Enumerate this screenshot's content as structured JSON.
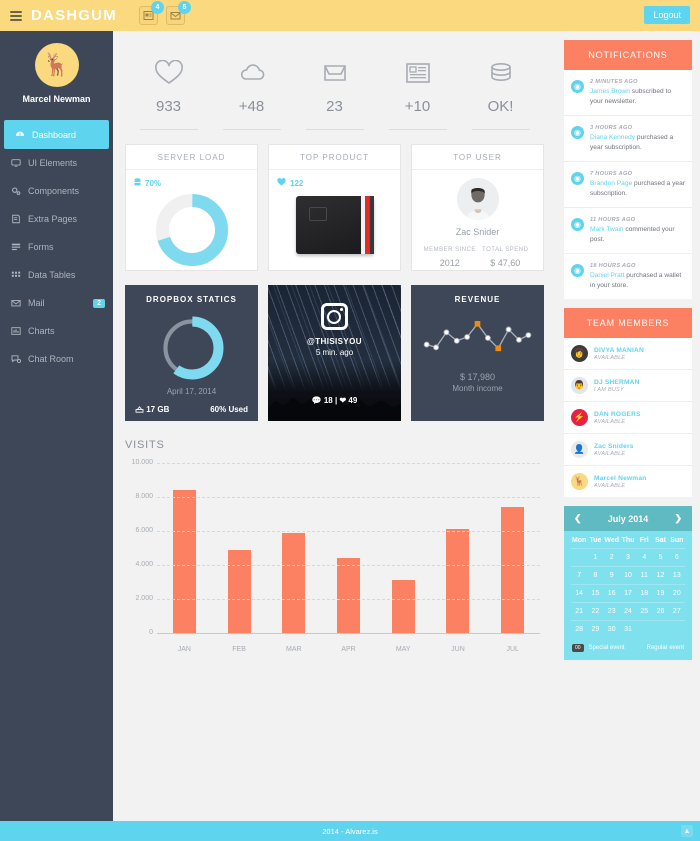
{
  "header": {
    "brand": "DASHGUM",
    "menu_icon": "hamburger-icon",
    "tasks_badge": "4",
    "mail_badge": "5",
    "logout_label": "Logout"
  },
  "sidebar": {
    "profile_name": "Marcel Newman",
    "avatar_glyph": "🦌",
    "items": [
      {
        "label": "Dashboard",
        "icon": "dashboard-icon",
        "active": true,
        "badge": ""
      },
      {
        "label": "UI Elements",
        "icon": "monitor-icon",
        "active": false,
        "badge": ""
      },
      {
        "label": "Components",
        "icon": "gear-icon",
        "active": false,
        "badge": ""
      },
      {
        "label": "Extra Pages",
        "icon": "book-icon",
        "active": false,
        "badge": ""
      },
      {
        "label": "Forms",
        "icon": "form-icon",
        "active": false,
        "badge": ""
      },
      {
        "label": "Data Tables",
        "icon": "grid-icon",
        "active": false,
        "badge": ""
      },
      {
        "label": "Mail",
        "icon": "envelope-icon",
        "active": false,
        "badge": "2"
      },
      {
        "label": "Charts",
        "icon": "chart-icon",
        "active": false,
        "badge": ""
      },
      {
        "label": "Chat Room",
        "icon": "chat-icon",
        "active": false,
        "badge": ""
      }
    ]
  },
  "stats": [
    {
      "icon": "heart-icon",
      "value": "933"
    },
    {
      "icon": "cloud-icon",
      "value": "+48"
    },
    {
      "icon": "inbox-icon",
      "value": "23"
    },
    {
      "icon": "newspaper-icon",
      "value": "+10"
    },
    {
      "icon": "database-icon",
      "value": "OK!"
    }
  ],
  "server_load": {
    "title": "SERVER LOAD",
    "mini_icon": "server-icon",
    "mini_value": "70%",
    "percent": 70
  },
  "top_product": {
    "title": "TOP PRODUCT",
    "mini_icon": "heart-icon",
    "mini_value": "122",
    "product": "black-wallet"
  },
  "top_user": {
    "title": "TOP USER",
    "name": "Zac Snider",
    "member_since_label": "MEMBER SINCE",
    "member_since_value": "2012",
    "total_spend_label": "TOTAL SPEND",
    "total_spend_value": "$ 47,60"
  },
  "dropbox": {
    "title": "DROPBOX STATICS",
    "date": "April 17, 2014",
    "size_icon": "dropbox-icon",
    "size": "17 GB",
    "used": "60% Used",
    "percent": 60
  },
  "instagram": {
    "logo_icon": "instagram-icon",
    "handle": "@THISISYOU",
    "time": "5 min. ago",
    "comments_icon": "comment-icon",
    "comments": "18",
    "separator": "|",
    "likes_icon": "heart-icon",
    "likes": "49"
  },
  "revenue": {
    "title": "REVENUE",
    "amount": "$ 17,980",
    "label": "Month income"
  },
  "chart_data": {
    "type": "bar",
    "title": "VISITS",
    "categories": [
      "JAN",
      "FEB",
      "MAR",
      "APR",
      "MAY",
      "JUN",
      "JUL"
    ],
    "values": [
      8400,
      4900,
      5900,
      4400,
      3100,
      6100,
      7400
    ],
    "ytick_labels": [
      "10.000",
      "8.000",
      "6.000",
      "4.000",
      "2.000",
      "0"
    ],
    "ytick_values": [
      10000,
      8000,
      6000,
      4000,
      2000,
      0
    ],
    "ylim": [
      0,
      10000
    ],
    "xlabel": "",
    "ylabel": "",
    "grid": true,
    "legend": "none",
    "bar_color": "#fc8062"
  },
  "notifications": {
    "title": "NOTIFICATIONS",
    "items": [
      {
        "icon": "clock-icon",
        "time": "2 MINUTES AGO",
        "user": "James Brown",
        "text": " subscribed to your newsletter."
      },
      {
        "icon": "clock-icon",
        "time": "3 HOURS AGO",
        "user": "Diana Kennedy",
        "text": " purchased a year subscription."
      },
      {
        "icon": "clock-icon",
        "time": "7 HOURS AGO",
        "user": "Brandon Page",
        "text": " purchased a year subscription."
      },
      {
        "icon": "clock-icon",
        "time": "11 HOURS AGO",
        "user": "Mark Twain",
        "text": " commented your post."
      },
      {
        "icon": "clock-icon",
        "time": "18 HOURS AGO",
        "user": "Daniel Pratt",
        "text": " purchased a wallet in your store."
      }
    ]
  },
  "team": {
    "title": "TEAM MEMBERS",
    "members": [
      {
        "name": "DIVYA MANIAN",
        "status": "AVAILABLE",
        "avatar": "photo-dark",
        "glyph": "👩",
        "color": "#3b3b3b"
      },
      {
        "name": "DJ SHERMAN",
        "status": "I AM BUSY",
        "avatar": "photo-light",
        "glyph": "👨",
        "color": "#dfe6ee"
      },
      {
        "name": "DAN ROGERS",
        "status": "AVAILABLE",
        "avatar": "bolt-red",
        "glyph": "⚡",
        "color": "#e52241"
      },
      {
        "name": "Zac Sniders",
        "status": "AVAILABLE",
        "avatar": "photo-gray",
        "glyph": "👤",
        "color": "#e8eaec"
      },
      {
        "name": "Marcel Newman",
        "status": "AVAILABLE",
        "avatar": "deer-yellow",
        "glyph": "🦌",
        "color": "#fad97f"
      }
    ]
  },
  "calendar": {
    "prev_icon": "chevron-left-icon",
    "next_icon": "chevron-right-icon",
    "month_label": "July 2014",
    "weekdays": [
      "Mon",
      "Tue",
      "Wed",
      "Thu",
      "Fri",
      "Sat",
      "Sun"
    ],
    "weeks": [
      [
        "",
        "1",
        "2",
        "3",
        "4",
        "5",
        "6"
      ],
      [
        "7",
        "8",
        "9",
        "10",
        "11",
        "12",
        "13"
      ],
      [
        "14",
        "15",
        "16",
        "17",
        "18",
        "19",
        "20"
      ],
      [
        "21",
        "22",
        "23",
        "24",
        "25",
        "26",
        "27"
      ],
      [
        "28",
        "29",
        "30",
        "31",
        "",
        "",
        ""
      ]
    ],
    "legend_chip": "00",
    "legend_special": "Special event",
    "legend_regular": "Regular event"
  },
  "footer": {
    "text": "2014 - Alvarez.is",
    "scroll_top_icon": "arrow-up-icon"
  },
  "colors": {
    "topbar": "#fad97f",
    "sidebar": "#3e4757",
    "accent_cyan": "#5fd4ee",
    "accent_orange": "#fc8062",
    "calendar": "#7fe0ee"
  }
}
